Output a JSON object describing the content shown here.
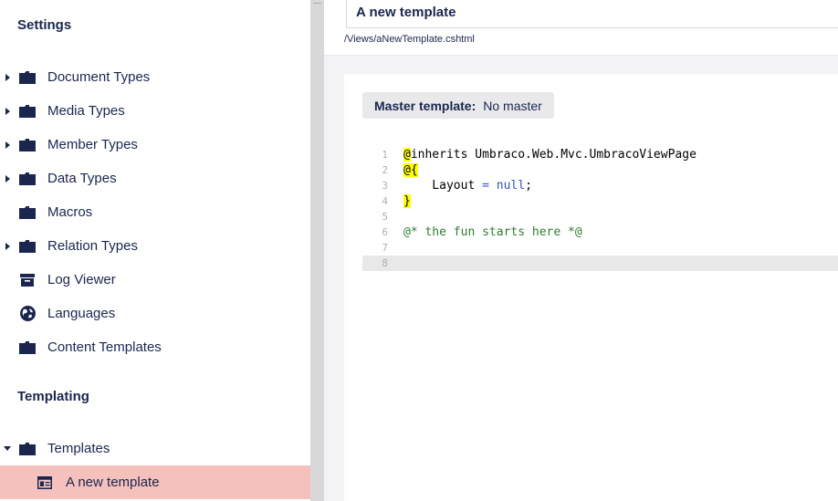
{
  "sidebar": {
    "settings_title": "Settings",
    "settings_items": [
      {
        "label": "Document Types",
        "icon": "folder-icon",
        "expandable": true
      },
      {
        "label": "Media Types",
        "icon": "folder-icon",
        "expandable": true
      },
      {
        "label": "Member Types",
        "icon": "folder-icon",
        "expandable": true
      },
      {
        "label": "Data Types",
        "icon": "folder-icon",
        "expandable": true
      },
      {
        "label": "Macros",
        "icon": "folder-icon",
        "expandable": false
      },
      {
        "label": "Relation Types",
        "icon": "folder-icon",
        "expandable": true
      },
      {
        "label": "Log Viewer",
        "icon": "archive-icon",
        "expandable": false
      },
      {
        "label": "Languages",
        "icon": "globe-icon",
        "expandable": false
      },
      {
        "label": "Content Templates",
        "icon": "folder-icon",
        "expandable": false
      }
    ],
    "templating_title": "Templating",
    "templating_items": [
      {
        "label": "Templates",
        "icon": "folder-icon",
        "expanded": true
      },
      {
        "label": "A new template",
        "icon": "template-icon",
        "selected": true
      }
    ]
  },
  "editor": {
    "template_name": "A new template",
    "path": "/Views/aNewTemplate.cshtml",
    "master_label": "Master template:",
    "master_value": "No master",
    "line_numbers": [
      "1",
      "2",
      "3",
      "4",
      "5",
      "6",
      "7",
      "8"
    ],
    "code": {
      "l1_at": "@",
      "l1_rest": "inherits Umbraco.Web.Mvc.UmbracoViewPage",
      "l2_open": "@{",
      "l3_indent": "    Layout ",
      "l3_eq": "=",
      "l3_null": "null",
      "l3_end": ";",
      "l4_close": "}",
      "l6_comment": "@* the fun starts here *@"
    }
  },
  "colors": {
    "navy": "#1b264f",
    "selected_bg": "#f5c1bc",
    "splitter": "#d8d7d9",
    "highlight": "#ffff00",
    "comment": "#2f7d2f"
  }
}
